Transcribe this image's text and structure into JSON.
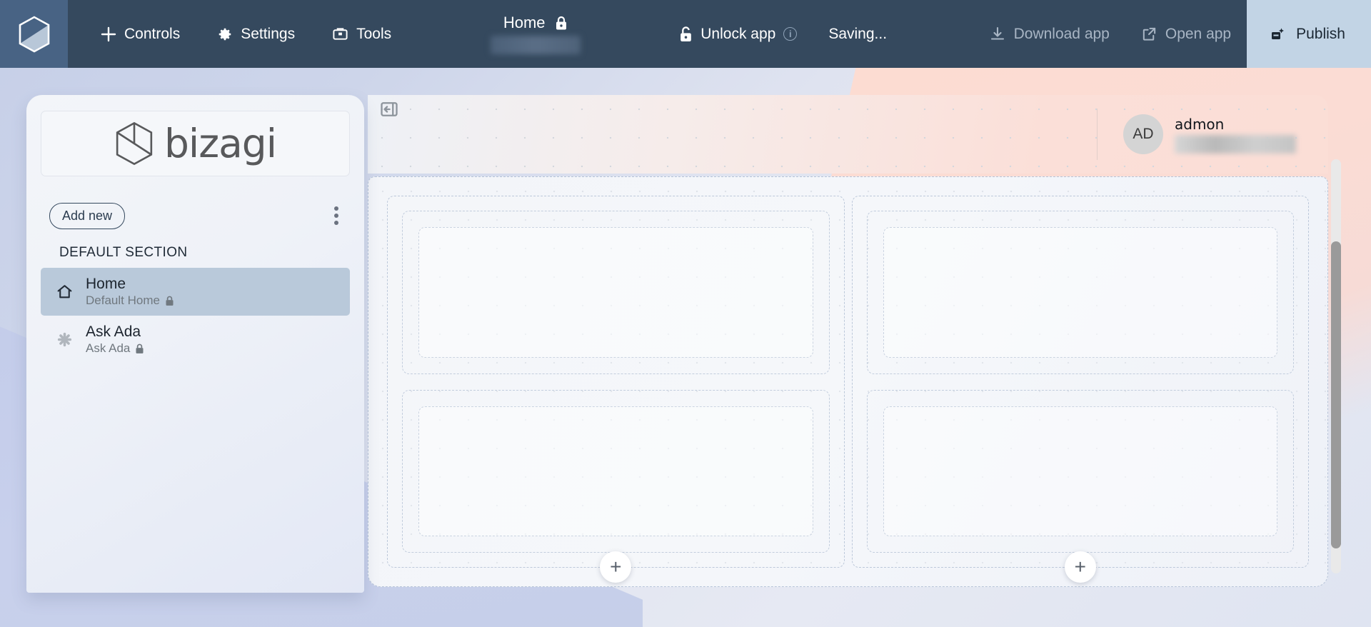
{
  "topbar": {
    "logo_icon": "bizagi-hexagon-icon",
    "items": [
      {
        "id": "controls",
        "label": "Controls",
        "icon": "plus-icon",
        "muted": false
      },
      {
        "id": "settings",
        "label": "Settings",
        "icon": "gear-icon",
        "muted": false
      },
      {
        "id": "tools",
        "label": "Tools",
        "icon": "toolbox-icon",
        "muted": false
      }
    ],
    "page_title": "Home",
    "page_title_icon": "lock-closed-icon",
    "unlock_label": "Unlock app",
    "unlock_icon": "lock-open-icon",
    "unlock_info_icon": "info-icon",
    "saving_label": "Saving...",
    "download_label": "Download app",
    "download_icon": "download-icon",
    "open_label": "Open app",
    "open_icon": "external-link-icon",
    "publish_label": "Publish",
    "publish_icon": "publish-icon",
    "publish_bg": "#c2d4e5",
    "bar_bg": "#35495e",
    "brand_bg": "#486384"
  },
  "sidebar": {
    "logo_text": "bizagi",
    "logo_icon": "bizagi-hexagon-icon",
    "add_new_label": "Add new",
    "more_menu_icon": "kebab-menu-icon",
    "section_label": "DEFAULT SECTION",
    "items": [
      {
        "id": "home",
        "title": "Home",
        "subtitle": "Default Home",
        "icon": "home-icon",
        "lock_icon": "lock-closed-icon",
        "active": true
      },
      {
        "id": "ask-ada",
        "title": "Ask Ada",
        "subtitle": "Ask Ada",
        "icon": "asterisk-icon",
        "lock_icon": "lock-closed-icon",
        "active": false
      }
    ]
  },
  "canvas": {
    "collapse_icon": "collapse-panel-icon",
    "user": {
      "initials": "AD",
      "name": "admon",
      "email_redacted": true
    },
    "columns": [
      {
        "id": "column-left",
        "slots": [
          {
            "id": "slot-left-top"
          },
          {
            "id": "slot-left-bottom"
          }
        ],
        "add_label": "+"
      },
      {
        "id": "column-right",
        "slots": [
          {
            "id": "slot-right-top"
          },
          {
            "id": "slot-right-bottom"
          }
        ],
        "add_label": "+"
      }
    ]
  },
  "colors": {
    "topbar": "#35495e",
    "brand": "#486384",
    "publish": "#c2d4e5",
    "active_nav": "#b9c9da",
    "accent_pink": "#fbdfd8",
    "accent_blue": "#c6cfe8"
  }
}
